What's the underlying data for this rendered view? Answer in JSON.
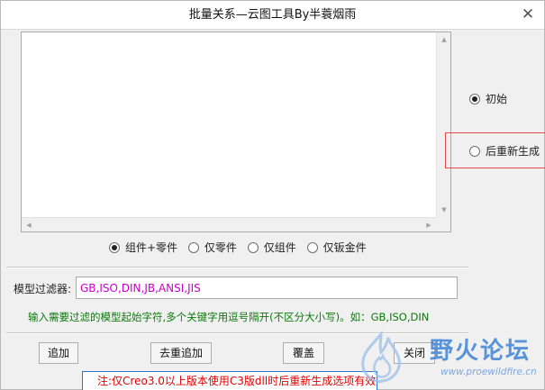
{
  "window": {
    "title": "批量关系—云图工具By半蓑烟雨"
  },
  "mode_options": [
    {
      "label": "初始",
      "selected": true
    },
    {
      "label": "后重新生成",
      "selected": false
    }
  ],
  "type_options": [
    {
      "label": "组件+零件",
      "selected": true
    },
    {
      "label": "仅零件",
      "selected": false
    },
    {
      "label": "仅组件",
      "selected": false
    },
    {
      "label": "仅钣金件",
      "selected": false
    }
  ],
  "filter": {
    "label": "模型过滤器:",
    "value": "GB,ISO,DIN,JB,ANSI,JIS"
  },
  "hint": "输入需要过滤的模型起始字符,多个关键字用逗号隔开(不区分大小写)。如：GB,ISO,DIN",
  "buttons": {
    "append": "追加",
    "dedup_append": "去重追加",
    "overwrite": "覆盖",
    "close": "关闭"
  },
  "notice": "注:仅Creo3.0以上版本使用C3版dll时后重新生成选项有效",
  "watermark": {
    "name": "野火论坛",
    "url": "www.proewildfire.cn"
  },
  "colors": {
    "filter_text": "#cc00cc",
    "hint_text": "#0a7a0a",
    "notice_text": "#e00000",
    "highlight_border": "#e04a4a",
    "watermark": "#3f83d6"
  }
}
